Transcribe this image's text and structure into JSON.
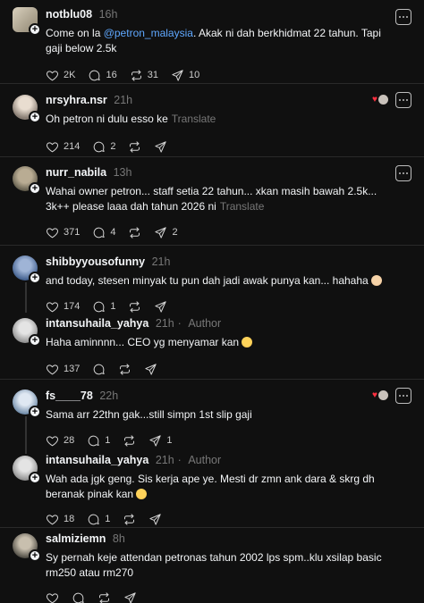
{
  "colors": {
    "background": "#101010",
    "mention": "#5fa8ff",
    "muted": "#777777",
    "liked_heart": "#ff3040"
  },
  "posts": [
    {
      "username": "notblu08",
      "time": "16h",
      "text_before": "Come on la ",
      "mention": "@petron_malaysia",
      "text_after": ". Akak ni dah berkhidmat 22 tahun. Tapi gaji below 2.5k",
      "likes": "2K",
      "replies": "16",
      "reposts": "31",
      "shares": "10"
    },
    {
      "username": "nrsyhra.nsr",
      "time": "21h",
      "text": "Oh petron ni dulu esso ke",
      "translate": "Translate",
      "likes": "214",
      "replies": "2",
      "reposts": "",
      "shares": ""
    },
    {
      "username": "nurr_nabila",
      "time": "13h",
      "text": "Wahai owner petron... staff setia 22 tahun... xkan masih bawah 2.5k... 3k++ please laaa dah tahun 2026 ni",
      "translate": "Translate",
      "likes": "371",
      "replies": "4",
      "reposts": "",
      "shares": "2"
    },
    {
      "username": "shibbyyousofunny",
      "time": "21h",
      "text": "and today, stesen minyak tu pun dah jadi awak punya kan... hahaha",
      "likes": "174",
      "replies": "1",
      "reposts": "",
      "shares": ""
    },
    {
      "username": "intansuhaila_yahya",
      "time": "21h",
      "author_tag": "Author",
      "text": "Haha aminnnn... CEO yg menyamar kan",
      "likes": "137",
      "replies": "",
      "reposts": "",
      "shares": ""
    },
    {
      "username": "fs____78",
      "time": "22h",
      "text": "Sama arr 22thn gak...still simpn 1st slip gaji",
      "likes": "28",
      "replies": "1",
      "reposts": "",
      "shares": "1"
    },
    {
      "username": "intansuhaila_yahya",
      "time": "21h",
      "author_tag": "Author",
      "text": "Wah ada jgk geng. Sis kerja ape ye. Mesti dr zmn ank dara & skrg dh beranak pinak kan",
      "likes": "18",
      "replies": "1",
      "reposts": "",
      "shares": ""
    },
    {
      "username": "salmiziemn",
      "time": "8h",
      "text": "Sy pernah keje attendan petronas tahun 2002 lps spm..klu xsilap basic rm250 atau rm270",
      "likes": "",
      "replies": "",
      "reposts": "",
      "shares": ""
    }
  ]
}
